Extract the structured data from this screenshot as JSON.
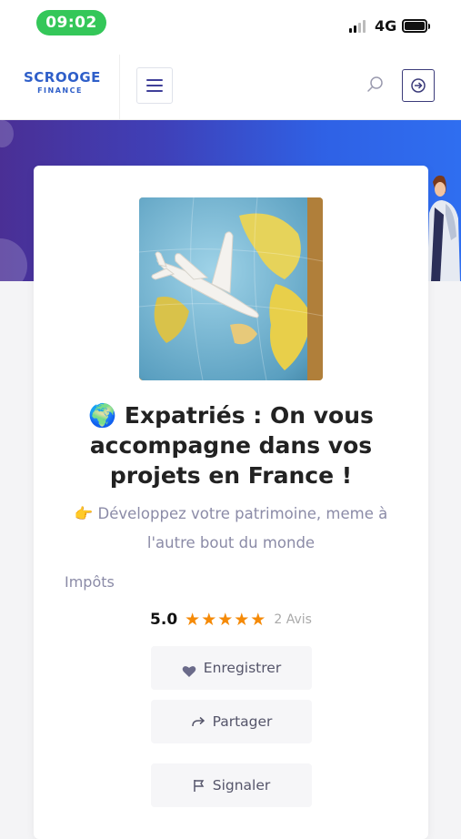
{
  "status_bar": {
    "time": "09:02",
    "network": "4G"
  },
  "nav": {
    "logo_line1": "SCROOGE",
    "logo_line2": "FINANCE"
  },
  "article": {
    "title": "🌍 Expatriés : On vous accompagne dans vos projets en France !",
    "subtitle": "👉 Développez votre patrimoine, meme à l'autre bout du monde",
    "category": "Impôts",
    "rating_score": "5.0",
    "rating_stars": "★★★★★",
    "reviews_count": "2 Avis"
  },
  "actions": {
    "save_label": "Enregistrer",
    "share_label": "Partager",
    "report_label": "Signaler"
  },
  "colors": {
    "accent": "#3f3f99",
    "brand_blue": "#2f5fc9",
    "star": "#f58a07",
    "status_pill": "#34c759"
  }
}
